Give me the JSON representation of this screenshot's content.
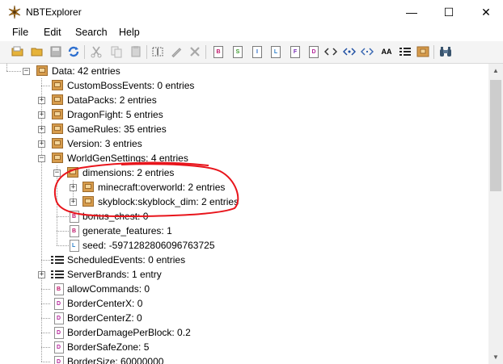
{
  "window": {
    "title": "NBTExplorer",
    "minimize_glyph": "—",
    "maximize_glyph": "☐",
    "close_glyph": "✕"
  },
  "menu": {
    "file": "File",
    "edit": "Edit",
    "search": "Search",
    "help": "Help"
  },
  "toolbar": {
    "tag_letters": [
      "B",
      "S",
      "I",
      "L",
      "F",
      "D"
    ],
    "aa_label": "AA"
  },
  "tree": {
    "rows": [
      {
        "label": "Data: 42 entries",
        "icon": "compound-icon"
      },
      {
        "label": "CustomBossEvents: 0 entries",
        "icon": "compound-icon"
      },
      {
        "label": "DataPacks: 2 entries",
        "icon": "compound-icon"
      },
      {
        "label": "DragonFight: 5 entries",
        "icon": "compound-icon"
      },
      {
        "label": "GameRules: 35 entries",
        "icon": "compound-icon"
      },
      {
        "label": "Version: 3 entries",
        "icon": "compound-icon"
      },
      {
        "label": "WorldGenSettings: 4 entries",
        "icon": "compound-icon"
      },
      {
        "label": "dimensions: 2 entries",
        "icon": "compound-icon"
      },
      {
        "label": "minecraft:overworld: 2 entries",
        "icon": "compound-icon"
      },
      {
        "label": "skyblock:skyblock_dim: 2 entries",
        "icon": "compound-icon"
      },
      {
        "label": "bonus_chest: 0",
        "icon": "byte-tag-icon",
        "tag": "B"
      },
      {
        "label": "generate_features: 1",
        "icon": "byte-tag-icon",
        "tag": "B"
      },
      {
        "label": "seed: -5971282806096763725",
        "icon": "long-tag-icon",
        "tag": "L"
      },
      {
        "label": "ScheduledEvents: 0 entries",
        "icon": "list-icon"
      },
      {
        "label": "ServerBrands: 1 entry",
        "icon": "list-icon"
      },
      {
        "label": "allowCommands: 0",
        "icon": "byte-tag-icon",
        "tag": "B"
      },
      {
        "label": "BorderCenterX: 0",
        "icon": "double-tag-icon",
        "tag": "D"
      },
      {
        "label": "BorderCenterZ: 0",
        "icon": "double-tag-icon",
        "tag": "D"
      },
      {
        "label": "BorderDamagePerBlock: 0.2",
        "icon": "double-tag-icon",
        "tag": "D"
      },
      {
        "label": "BorderSafeZone: 5",
        "icon": "double-tag-icon",
        "tag": "D"
      },
      {
        "label": "BorderSize: 60000000",
        "icon": "double-tag-icon",
        "tag": "D"
      }
    ],
    "collapsed_glyph": "+",
    "expanded_glyph": "−"
  },
  "colors": {
    "annotation": "#e8141b",
    "folder": "#e6b33a",
    "compound": "#d79c4c"
  }
}
